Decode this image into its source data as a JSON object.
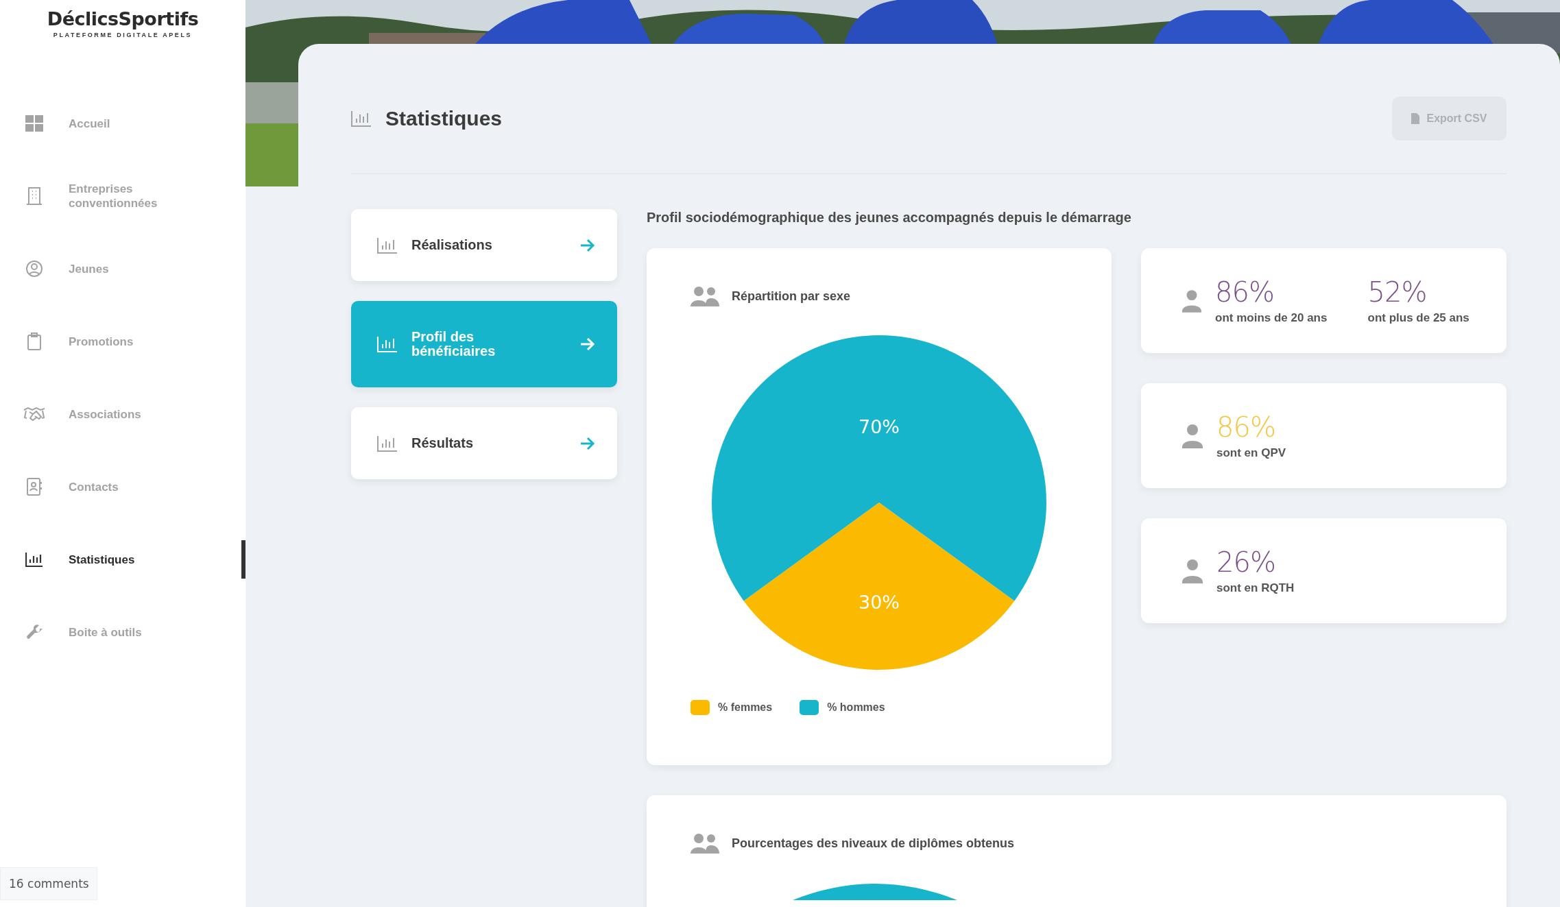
{
  "sidebar": {
    "logo": {
      "name": "DéclicsSportifs",
      "tagline": "PLATEFORME DIGITALE APELS"
    },
    "items": [
      {
        "label": "Accueil",
        "selected": false
      },
      {
        "label": "Entreprises conventionnées",
        "selected": false
      },
      {
        "label": "Jeunes",
        "selected": false
      },
      {
        "label": "Promotions",
        "selected": false
      },
      {
        "label": "Associations",
        "selected": false
      },
      {
        "label": "Contacts",
        "selected": false
      },
      {
        "label": "Statistiques",
        "selected": true
      },
      {
        "label": "Boite à outils",
        "selected": false
      }
    ]
  },
  "comments_badge": "16 comments",
  "header": {
    "title": "Statistiques",
    "export_button": "Export CSV"
  },
  "tabs": [
    {
      "label": "Réalisations",
      "selected": false
    },
    {
      "label": "Profil des bénéficiaires",
      "selected": true
    },
    {
      "label": "Résultats",
      "selected": false
    }
  ],
  "section_title": "Profil sociodémographique des jeunes accompagnés depuis le démarrage",
  "gender_card": {
    "title": "Répartition par sexe",
    "chart_data": {
      "type": "pie",
      "categories": [
        "% femmes",
        "% hommes"
      ],
      "values": [
        30,
        70
      ],
      "colors": [
        "#fbba00",
        "#17b5cc"
      ],
      "value_labels": [
        "30%",
        "70%"
      ]
    }
  },
  "stat_cards": [
    {
      "items": [
        {
          "value": "86%",
          "label": "ont moins de 20 ans",
          "color": "#7b4f8a"
        },
        {
          "value": "52%",
          "label": "ont plus de 25 ans",
          "color": "#7b4f8a"
        }
      ]
    },
    {
      "items": [
        {
          "value": "86%",
          "label": "sont en QPV",
          "color": "#f6c542"
        }
      ]
    },
    {
      "items": [
        {
          "value": "26%",
          "label": "sont en RQTH",
          "color": "#7b4f8a"
        }
      ]
    }
  ],
  "diploma_card": {
    "title": "Pourcentages des niveaux de diplômes obtenus"
  }
}
